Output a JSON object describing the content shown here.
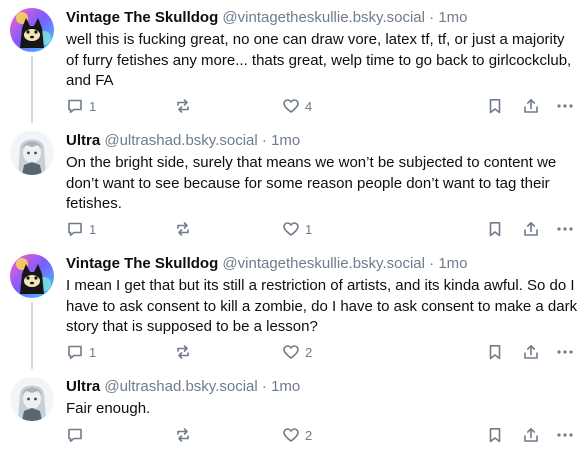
{
  "posts": [
    {
      "display_name": "Vintage The Skulldog",
      "handle": "@vintagetheskullie.bsky.social",
      "separator": "·",
      "time": "1mo",
      "text": "well this is fucking great, no one can draw vore, latex tf, tf, or just a majority of furry fetishes any more... thats great, welp time to go back to girlcockclub, and FA",
      "reply_count": "1",
      "like_count": "4"
    },
    {
      "display_name": "Ultra",
      "handle": "@ultrashad.bsky.social",
      "separator": "·",
      "time": "1mo",
      "text": "On the bright side, surely that means we won’t be subjected to content we don’t want to see because for some reason people don’t want to tag their fetishes.",
      "reply_count": "1",
      "like_count": "1"
    },
    {
      "display_name": "Vintage The Skulldog",
      "handle": "@vintagetheskullie.bsky.social",
      "separator": "·",
      "time": "1mo",
      "text": "I mean I get that but its still a restriction of artists, and its kinda awful. So do I have to ask consent to kill a zombie, do I have to ask consent to make a dark story that is supposed to be a lesson?",
      "reply_count": "1",
      "like_count": "2"
    },
    {
      "display_name": "Ultra",
      "handle": "@ultrashad.bsky.social",
      "separator": "·",
      "time": "1mo",
      "text": "Fair enough.",
      "reply_count": "",
      "like_count": "2"
    }
  ],
  "icons": {
    "reply": "reply-icon",
    "repost": "repost-icon",
    "like": "heart-icon",
    "bookmark": "bookmark-icon",
    "share": "share-icon",
    "more": "more-icon"
  },
  "colors": {
    "text": "#0b0f14",
    "muted": "#6f7c8b",
    "thread_line": "#d4dbe2"
  }
}
